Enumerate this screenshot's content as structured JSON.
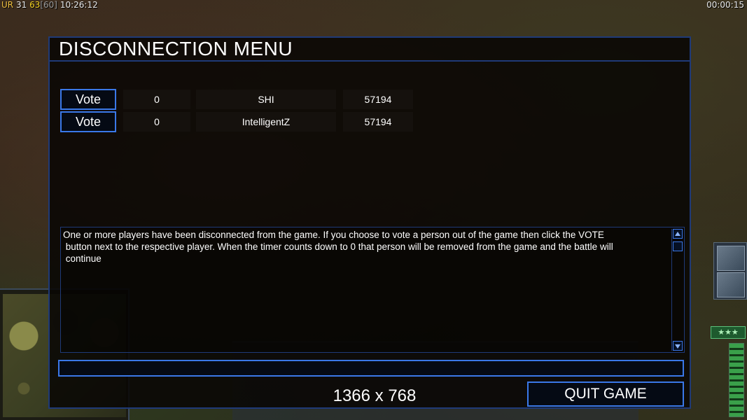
{
  "hud": {
    "ur_label": "UR",
    "ur_value": "31",
    "fps": "63",
    "fps_cap": "[60]",
    "clock": "10:26:12",
    "game_timer": "00:00:15"
  },
  "dialog": {
    "title": "DISCONNECTION MENU",
    "players": [
      {
        "vote_label": "Vote",
        "count": "0",
        "name": "SHI",
        "value": "57194"
      },
      {
        "vote_label": "Vote",
        "count": "0",
        "name": "IntelligentZ",
        "value": "57194"
      }
    ],
    "info_text": "One or more players have been disconnected from the game. If you choose to vote a person out of the game then click the VOTE\n button next to the respective player. When the timer counts down to 0 that person will be removed from the game and the battle will\n continue",
    "chat_input_value": "",
    "resolution": "1366 x 768",
    "quit_label": "QUIT GAME"
  },
  "background": {
    "rank_stars": "★★★"
  },
  "colors": {
    "accent_border": "#3a78e8",
    "frame_border": "#1f3a78",
    "text": "#ffffff"
  }
}
